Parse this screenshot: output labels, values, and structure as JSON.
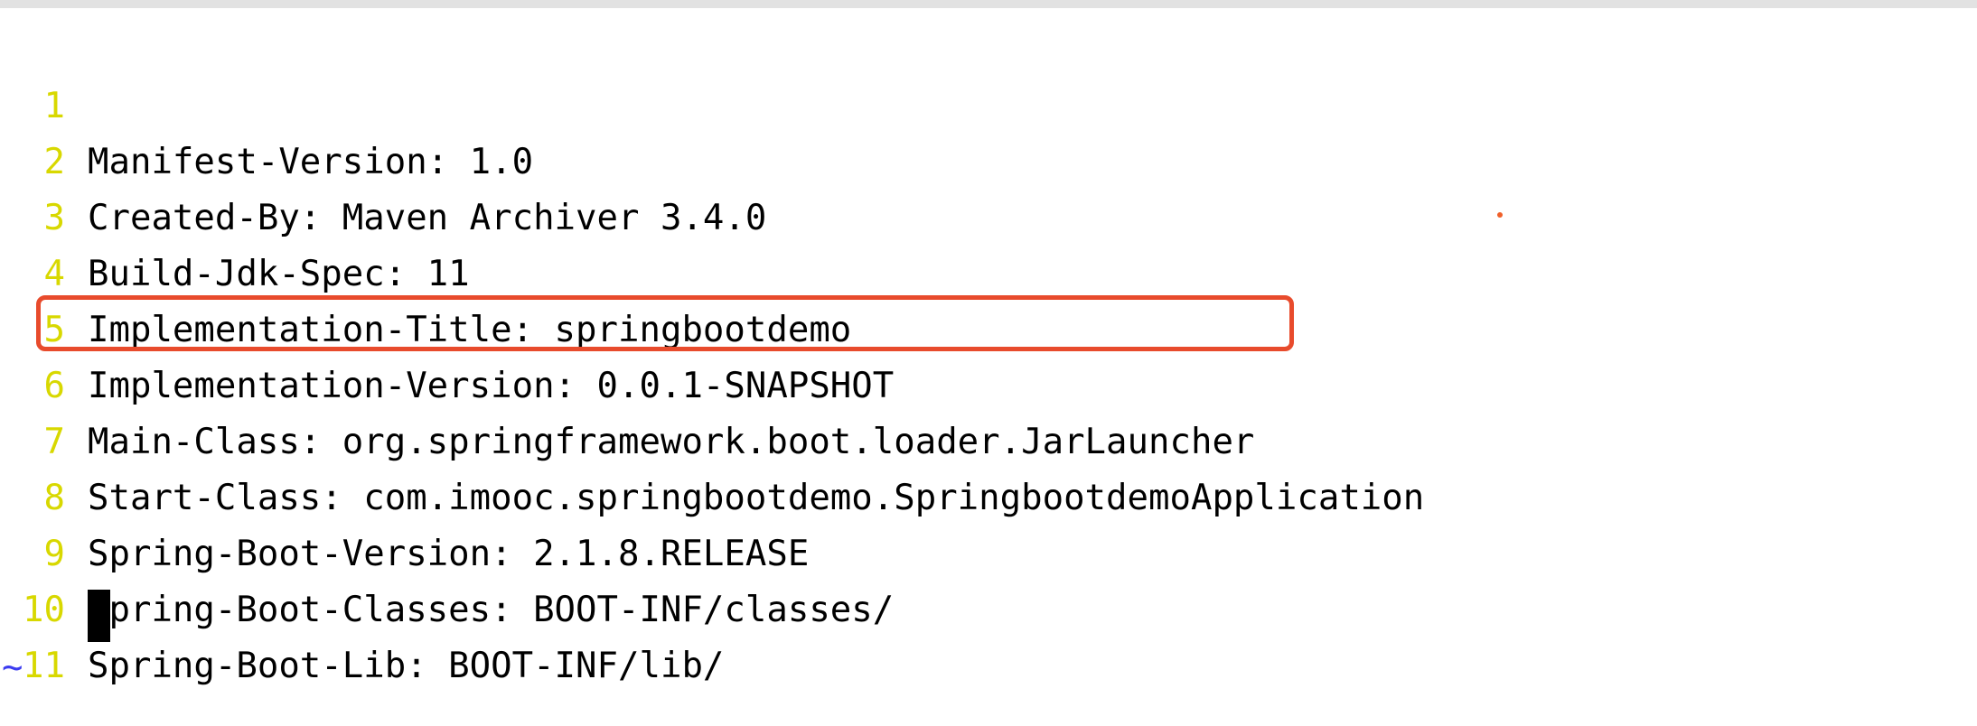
{
  "editor": {
    "lines": [
      {
        "number": "1",
        "text": "Manifest-Version: 1.0"
      },
      {
        "number": "2",
        "text": "Created-By: Maven Archiver 3.4.0"
      },
      {
        "number": "3",
        "text": "Build-Jdk-Spec: 11"
      },
      {
        "number": "4",
        "text": "Implementation-Title: springbootdemo"
      },
      {
        "number": "5",
        "text": "Implementation-Version: 0.0.1-SNAPSHOT"
      },
      {
        "number": "6",
        "text": "Main-Class: org.springframework.boot.loader.JarLauncher"
      },
      {
        "number": "7",
        "text": "Start-Class: com.imooc.springbootdemo.SpringbootdemoApplication"
      },
      {
        "number": "8",
        "text": "Spring-Boot-Version: 2.1.8.RELEASE"
      },
      {
        "number": "9",
        "text": "Spring-Boot-Classes: BOOT-INF/classes/"
      },
      {
        "number": "10",
        "text": "Spring-Boot-Lib: BOOT-INF/lib/"
      },
      {
        "number": "11",
        "text": ""
      }
    ],
    "empty_line_marker": "~",
    "highlighted_line": "6",
    "colors": {
      "line_number": "#d8d800",
      "text": "#000000",
      "tilde": "#3c3cf0",
      "highlight_border": "#e84b2c"
    }
  }
}
